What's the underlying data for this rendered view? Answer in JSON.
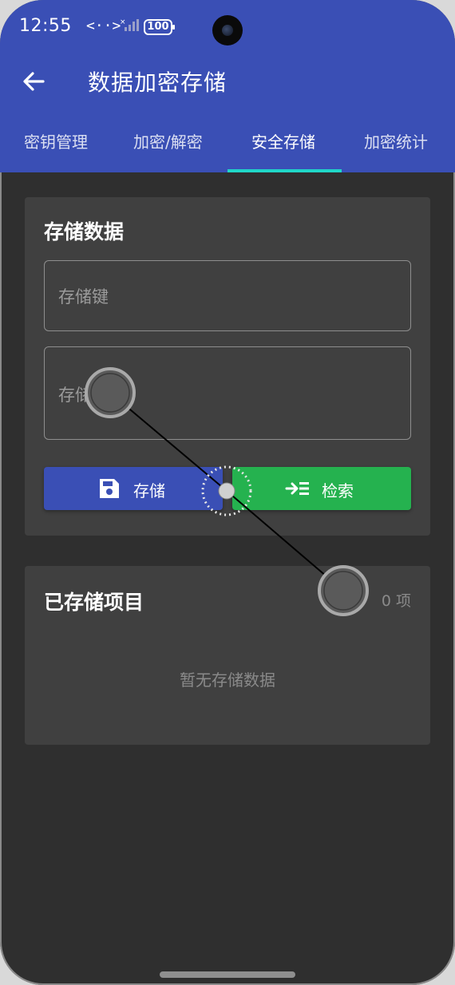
{
  "status": {
    "time": "12:55",
    "signal_text": "<··>",
    "battery": "100"
  },
  "toolbar": {
    "title": "数据加密存储",
    "back_icon": "arrow-left-icon"
  },
  "tabs": [
    {
      "label": "密钥管理",
      "active": false
    },
    {
      "label": "加密/解密",
      "active": false
    },
    {
      "label": "安全存储",
      "active": true
    },
    {
      "label": "加密统计",
      "active": false
    }
  ],
  "store_card": {
    "title": "存储数据",
    "key_placeholder": "存储键",
    "value_placeholder": "存储值",
    "store_button": {
      "label": "存储",
      "icon": "save-icon"
    },
    "retrieve_button": {
      "label": "检索",
      "icon": "retrieve-icon"
    }
  },
  "stored_card": {
    "title": "已存储项目",
    "count": "0 项",
    "empty_text": "暂无存储数据"
  },
  "colors": {
    "primary": "#3a4fb5",
    "accent": "#20d6c8",
    "success": "#25b24f",
    "background": "#2f2f2f",
    "card": "#404040"
  }
}
